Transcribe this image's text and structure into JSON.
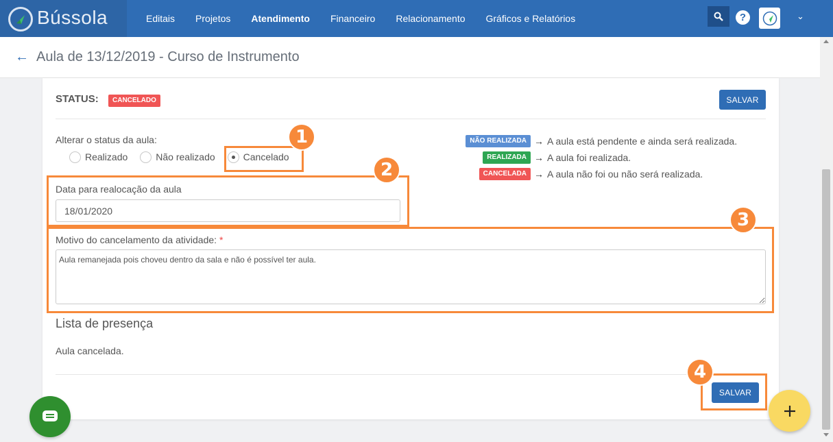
{
  "nav": {
    "brand": "Bússola",
    "menu": [
      "Editais",
      "Projetos",
      "Atendimento",
      "Financeiro",
      "Relacionamento",
      "Gráficos e Relatórios"
    ],
    "active_menu": "Atendimento"
  },
  "page": {
    "title": "Aula de 13/12/2019 - Curso de Instrumento"
  },
  "status": {
    "label": "STATUS:",
    "value_badge": "CANCELADO",
    "save_label": "SALVAR"
  },
  "change_status": {
    "label": "Alterar o status da aula:",
    "options": [
      "Realizado",
      "Não realizado",
      "Cancelado"
    ],
    "selected": "Cancelado"
  },
  "legend": [
    {
      "badge": "NÃO REALIZADA",
      "text": "A aula está pendente e ainda será realizada.",
      "color": "#5b8fd4"
    },
    {
      "badge": "REALIZADA",
      "text": "A aula foi realizada.",
      "color": "#2ea653"
    },
    {
      "badge": "CANCELADA",
      "text": "A aula não foi ou não será realizada.",
      "color": "#f05555"
    }
  ],
  "reallocation": {
    "label": "Data para realocação da aula",
    "value": "18/01/2020"
  },
  "reason": {
    "label": "Motivo do cancelamento da atividade:",
    "required_mark": "*",
    "value": "Aula remanejada pois choveu dentro da sala e não é possível ter aula."
  },
  "attendance": {
    "title": "Lista de presença",
    "note": "Aula cancelada."
  },
  "footer": {
    "save_label": "SALVAR"
  },
  "callouts": [
    "1",
    "2",
    "3",
    "4"
  ],
  "colors": {
    "nav": "#2f6db5",
    "highlight": "#f7893a",
    "fab": "#f9d962",
    "chat": "#2f8f2f"
  }
}
